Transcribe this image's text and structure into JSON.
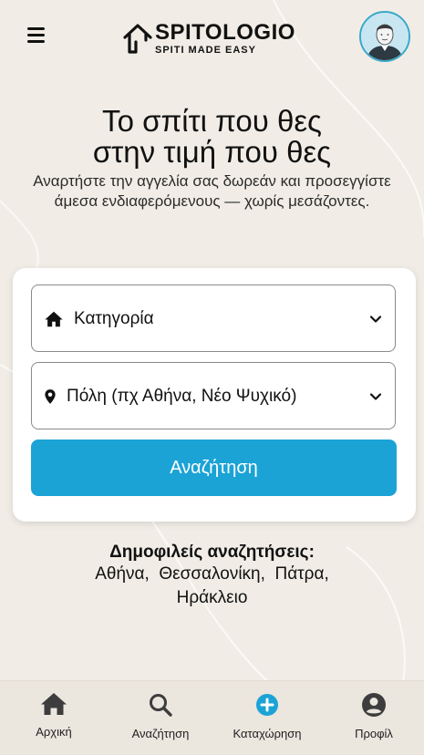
{
  "header": {
    "brand_name": "SPITOLOGIO",
    "brand_tagline": "SPITI MADE EASY",
    "menu_icon": "hamburger-icon",
    "avatar_icon": "user-avatar-icon"
  },
  "hero": {
    "title_line1": "Το σπίτι που θες",
    "title_line2": "στην τιμή που θες",
    "subtitle": "Αναρτήστε την αγγελία σας δωρεάν και προσεγγίστε άμεσα ενδιαφερόμενους — χωρίς μεσάζοντες."
  },
  "search": {
    "category_placeholder": "Κατηγορία",
    "category_icon": "home-icon",
    "city_placeholder": "Πόλη (πχ Αθήνα, Νέο Ψυχικό)",
    "city_icon": "location-pin-icon",
    "button_label": "Αναζήτηση"
  },
  "popular": {
    "title": "Δημοφιλείς αναζητήσεις:",
    "links": [
      "Αθήνα,",
      "Θεσσαλονίκη,",
      "Πάτρα,",
      "Ηράκλειο"
    ]
  },
  "bottom_nav": {
    "items": [
      {
        "label": "Αρχική",
        "icon": "home-icon"
      },
      {
        "label": "Αναζήτηση",
        "icon": "search-icon"
      },
      {
        "label": "Καταχώρηση",
        "icon": "add-circle-icon"
      },
      {
        "label": "Προφίλ",
        "icon": "profile-icon"
      }
    ]
  },
  "colors": {
    "background": "#f1ede6",
    "accent": "#1ba3d6",
    "nav_background": "#ebe6de",
    "text": "#111111"
  }
}
